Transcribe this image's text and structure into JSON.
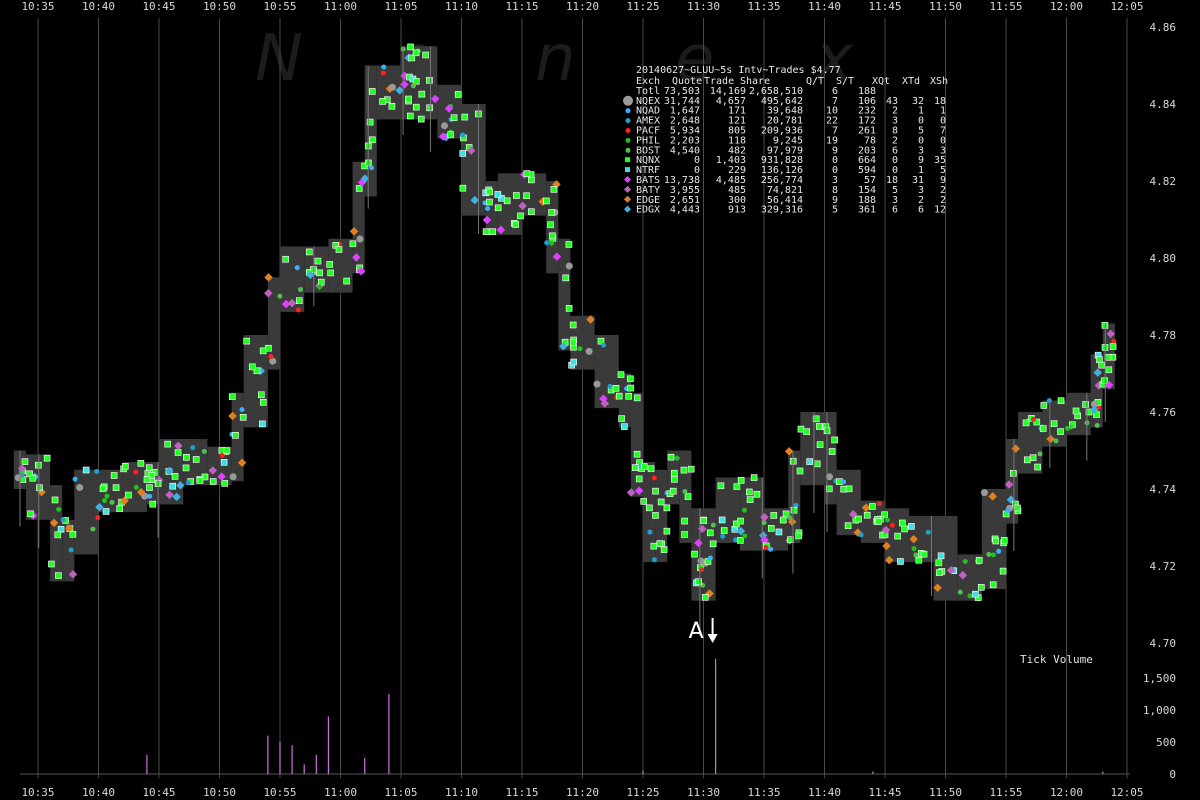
{
  "chart_data": {
    "type": "scatter",
    "title": "20140627~GLUU~5s Intv~Trades $4.77",
    "watermark": "Nanex",
    "x_axis": {
      "ticks": [
        "10:35",
        "10:40",
        "10:45",
        "10:50",
        "10:55",
        "11:00",
        "11:05",
        "11:10",
        "11:15",
        "11:20",
        "11:25",
        "11:30",
        "11:35",
        "11:40",
        "11:45",
        "11:50",
        "11:55",
        "12:00",
        "12:05"
      ],
      "range": [
        "10:33",
        "12:06"
      ]
    },
    "y_axis_price": {
      "ticks": [
        "4.86",
        "4.84",
        "4.82",
        "4.80",
        "4.78",
        "4.76",
        "4.74",
        "4.72",
        "4.70"
      ],
      "range": [
        4.699,
        4.862
      ]
    },
    "y_axis_volume": {
      "label": "Tick Volume",
      "ticks": [
        "1,500",
        "1,000",
        "500",
        "0"
      ],
      "range": [
        0,
        1800
      ]
    },
    "grid": "vertical",
    "legend_header": [
      "Exch",
      "Quote",
      "Trade",
      "Share",
      "Q/T",
      "S/T",
      "XQt",
      "XTd",
      "XSh"
    ],
    "legend_rows": [
      {
        "exch": "Totl",
        "quote": "73,503",
        "trade": "14,169",
        "share": "2,658,510",
        "qt": "6",
        "st": "188",
        "xqt": "",
        "xtd": "",
        "xsh": "",
        "color": "#9a9a9a",
        "marker": "none"
      },
      {
        "exch": "NQEX",
        "quote": "31,744",
        "trade": "4,657",
        "share": "495,642",
        "qt": "7",
        "st": "106",
        "xqt": "43",
        "xtd": "32",
        "xsh": "18",
        "color": "#9a9a9a",
        "marker": "big-circle"
      },
      {
        "exch": "NQAD",
        "quote": "1,647",
        "trade": "171",
        "share": "39,648",
        "qt": "10",
        "st": "232",
        "xqt": "2",
        "xtd": "1",
        "xsh": "1",
        "color": "#3ab0ff",
        "marker": "circle"
      },
      {
        "exch": "AMEX",
        "quote": "2,648",
        "trade": "121",
        "share": "20,781",
        "qt": "22",
        "st": "172",
        "xqt": "3",
        "xtd": "0",
        "xsh": "0",
        "color": "#20a0d0",
        "marker": "circle"
      },
      {
        "exch": "PACF",
        "quote": "5,934",
        "trade": "805",
        "share": "209,936",
        "qt": "7",
        "st": "261",
        "xqt": "8",
        "xtd": "5",
        "xsh": "7",
        "color": "#ff2020",
        "marker": "circle"
      },
      {
        "exch": "PHIL",
        "quote": "2,203",
        "trade": "118",
        "share": "9,245",
        "qt": "19",
        "st": "78",
        "xqt": "2",
        "xtd": "0",
        "xsh": "0",
        "color": "#20c020",
        "marker": "circle"
      },
      {
        "exch": "BOST",
        "quote": "4,540",
        "trade": "482",
        "share": "97,979",
        "qt": "9",
        "st": "203",
        "xqt": "6",
        "xtd": "3",
        "xsh": "3",
        "color": "#50c050",
        "marker": "circle"
      },
      {
        "exch": "NQNX",
        "quote": "0",
        "trade": "1,403",
        "share": "931,828",
        "qt": "0",
        "st": "664",
        "xqt": "0",
        "xtd": "9",
        "xsh": "35",
        "color": "#20ff20",
        "marker": "square"
      },
      {
        "exch": "NTRF",
        "quote": "0",
        "trade": "229",
        "share": "136,126",
        "qt": "0",
        "st": "594",
        "xqt": "0",
        "xtd": "1",
        "xsh": "5",
        "color": "#40e0e0",
        "marker": "square"
      },
      {
        "exch": "BATS",
        "quote": "13,738",
        "trade": "4,485",
        "share": "256,774",
        "qt": "3",
        "st": "57",
        "xqt": "18",
        "xtd": "31",
        "xsh": "9",
        "color": "#e040ff",
        "marker": "diamond"
      },
      {
        "exch": "BATY",
        "quote": "3,955",
        "trade": "485",
        "share": "74,821",
        "qt": "8",
        "st": "154",
        "xqt": "5",
        "xtd": "3",
        "xsh": "2",
        "color": "#c060c0",
        "marker": "diamond"
      },
      {
        "exch": "EDGE",
        "quote": "2,651",
        "trade": "300",
        "share": "56,414",
        "qt": "9",
        "st": "188",
        "xqt": "3",
        "xtd": "2",
        "xsh": "2",
        "color": "#e08020",
        "marker": "diamond"
      },
      {
        "exch": "EDGX",
        "quote": "4,443",
        "trade": "913",
        "share": "329,316",
        "qt": "5",
        "st": "361",
        "xqt": "6",
        "xtd": "6",
        "xsh": "12",
        "color": "#40b0e0",
        "marker": "diamond"
      }
    ],
    "price_path": [
      {
        "t": "10:33",
        "p": 4.745
      },
      {
        "t": "10:34",
        "p": 4.744
      },
      {
        "t": "10:36",
        "p": 4.736
      },
      {
        "t": "10:37",
        "p": 4.72
      },
      {
        "t": "10:38",
        "p": 4.727
      },
      {
        "t": "10:40",
        "p": 4.74
      },
      {
        "t": "10:42",
        "p": 4.738
      },
      {
        "t": "10:44",
        "p": 4.742
      },
      {
        "t": "10:45",
        "p": 4.74
      },
      {
        "t": "10:47",
        "p": 4.748
      },
      {
        "t": "10:49",
        "p": 4.745
      },
      {
        "t": "10:51",
        "p": 4.746
      },
      {
        "t": "10:52",
        "p": 4.76
      },
      {
        "t": "10:54",
        "p": 4.775
      },
      {
        "t": "10:55",
        "p": 4.79
      },
      {
        "t": "10:57",
        "p": 4.798
      },
      {
        "t": "10:59",
        "p": 4.795
      },
      {
        "t": "11:01",
        "p": 4.8
      },
      {
        "t": "11:02",
        "p": 4.82
      },
      {
        "t": "11:03",
        "p": 4.845
      },
      {
        "t": "11:05",
        "p": 4.84
      },
      {
        "t": "11:06",
        "p": 4.85
      },
      {
        "t": "11:08",
        "p": 4.84
      },
      {
        "t": "11:10",
        "p": 4.835
      },
      {
        "t": "11:12",
        "p": 4.815
      },
      {
        "t": "11:13",
        "p": 4.81
      },
      {
        "t": "11:15",
        "p": 4.817
      },
      {
        "t": "11:17",
        "p": 4.815
      },
      {
        "t": "11:18",
        "p": 4.8
      },
      {
        "t": "11:19",
        "p": 4.78
      },
      {
        "t": "11:21",
        "p": 4.775
      },
      {
        "t": "11:23",
        "p": 4.765
      },
      {
        "t": "11:24",
        "p": 4.76
      },
      {
        "t": "11:25",
        "p": 4.742
      },
      {
        "t": "11:26",
        "p": 4.725
      },
      {
        "t": "11:27",
        "p": 4.74
      },
      {
        "t": "11:28",
        "p": 4.745
      },
      {
        "t": "11:29",
        "p": 4.73
      },
      {
        "t": "11:30",
        "p": 4.715
      },
      {
        "t": "11:31",
        "p": 4.73
      },
      {
        "t": "11:33",
        "p": 4.738
      },
      {
        "t": "11:35",
        "p": 4.728
      },
      {
        "t": "11:37",
        "p": 4.73
      },
      {
        "t": "11:38",
        "p": 4.745
      },
      {
        "t": "11:40",
        "p": 4.755
      },
      {
        "t": "11:41",
        "p": 4.74
      },
      {
        "t": "11:43",
        "p": 4.732
      },
      {
        "t": "11:45",
        "p": 4.73
      },
      {
        "t": "11:47",
        "p": 4.725
      },
      {
        "t": "11:49",
        "p": 4.728
      },
      {
        "t": "11:51",
        "p": 4.715
      },
      {
        "t": "11:53",
        "p": 4.718
      },
      {
        "t": "11:55",
        "p": 4.735
      },
      {
        "t": "11:56",
        "p": 4.748
      },
      {
        "t": "11:58",
        "p": 4.755
      },
      {
        "t": "12:00",
        "p": 4.758
      },
      {
        "t": "12:02",
        "p": 4.76
      },
      {
        "t": "12:03",
        "p": 4.77
      },
      {
        "t": "12:04",
        "p": 4.778
      }
    ],
    "volume_spikes": [
      {
        "t": "10:44",
        "v": 300
      },
      {
        "t": "10:54",
        "v": 600
      },
      {
        "t": "10:55",
        "v": 500
      },
      {
        "t": "10:56",
        "v": 450
      },
      {
        "t": "10:57",
        "v": 150
      },
      {
        "t": "10:58",
        "v": 300
      },
      {
        "t": "10:59",
        "v": 900
      },
      {
        "t": "11:02",
        "v": 250
      },
      {
        "t": "11:04",
        "v": 1250
      },
      {
        "t": "11:25",
        "v": 50
      },
      {
        "t": "11:31",
        "v": 1800
      },
      {
        "t": "11:44",
        "v": 40
      },
      {
        "t": "12:03",
        "v": 40
      }
    ],
    "annotations": [
      {
        "label": "A",
        "t": "11:31",
        "p": 4.7
      }
    ]
  }
}
